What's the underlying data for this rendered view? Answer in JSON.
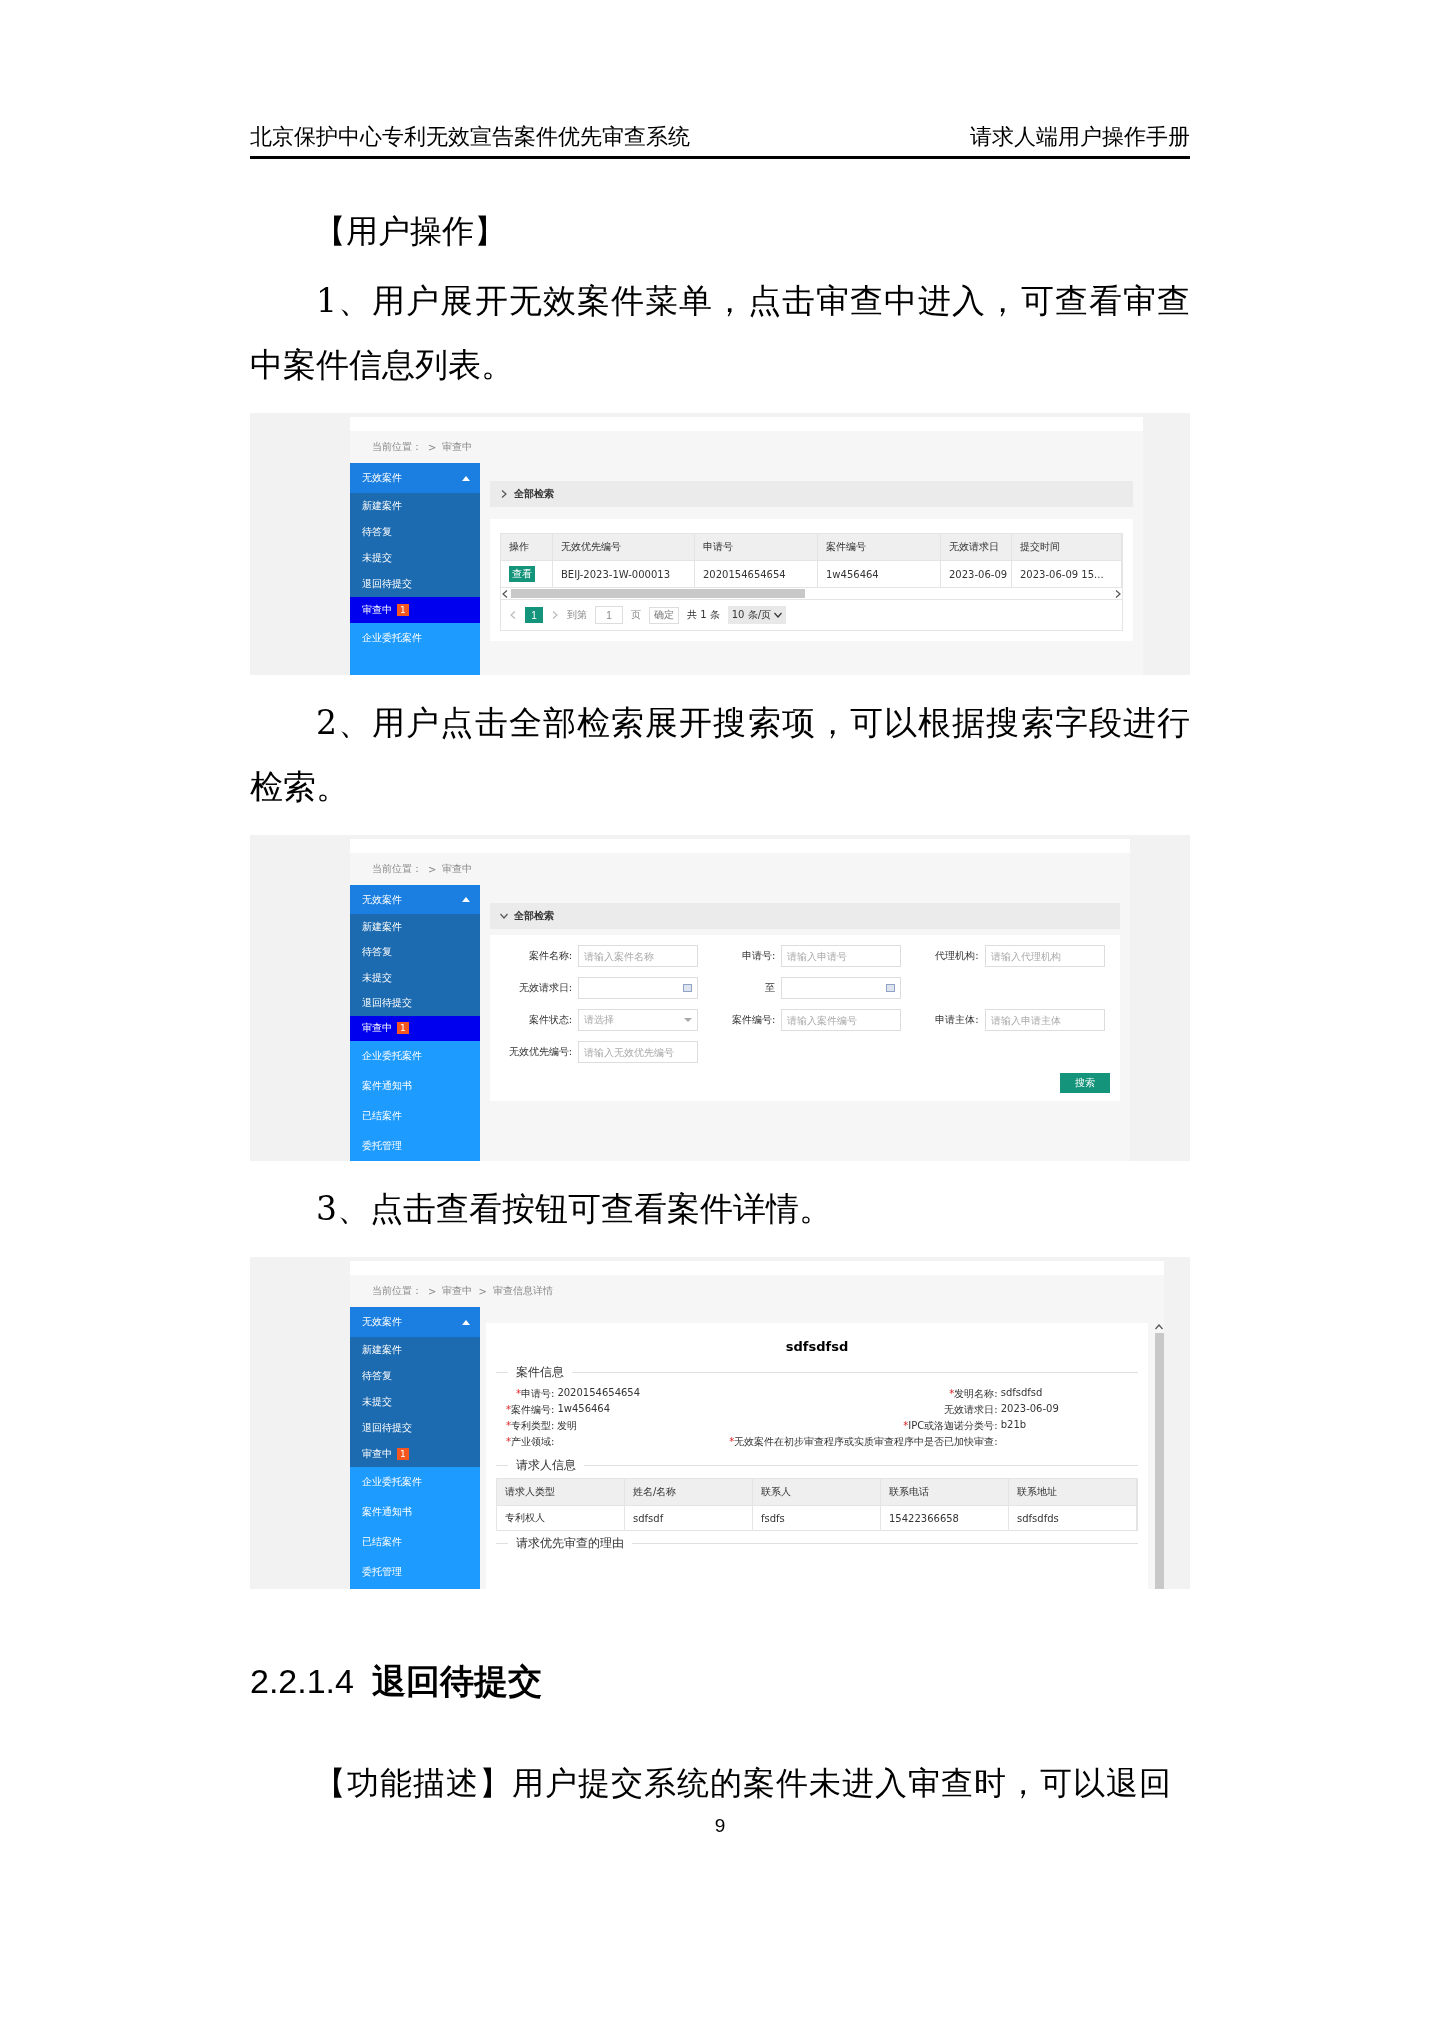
{
  "header": {
    "left": "北京保护中心专利无效宣告案件优先审查系统",
    "right": "请求人端用户操作手册"
  },
  "section_label": "【用户操作】",
  "steps": [
    {
      "text": "1、用户展开无效案件菜单，点击审查中进入，可查看审查中案件信息列表。",
      "screen": {
        "kind": "list",
        "breadcrumb": [
          "当前位置：",
          ">",
          "审查中"
        ],
        "sidebar": {
          "title": "无效案件",
          "expanded": true,
          "items": [
            {
              "label": "新建案件",
              "selected": false
            },
            {
              "label": "待答复",
              "selected": false
            },
            {
              "label": "未提交",
              "selected": false
            },
            {
              "label": "退回待提交",
              "selected": false
            },
            {
              "label": "审查中",
              "selected": true,
              "badge": "1"
            }
          ],
          "other_items": [
            "企业委托案件"
          ]
        },
        "filter": {
          "label": "全部检索",
          "expanded": false
        },
        "table": {
          "columns": [
            {
              "label": "操作",
              "kind": "action"
            },
            {
              "label": "无效优先编号",
              "kind": "text"
            },
            {
              "label": "申请号",
              "kind": "text"
            },
            {
              "label": "案件编号",
              "kind": "text"
            },
            {
              "label": "无效请求日",
              "kind": "text"
            },
            {
              "label": "提交时间",
              "kind": "text"
            }
          ],
          "rows": [
            [
              "查看",
              "BEIJ-2023-1W-000013",
              "2020154654654",
              "1w456464",
              "2023-06-09",
              "2023-06-09 15..."
            ]
          ]
        },
        "pagination": {
          "pages": [
            {
              "label": "1",
              "selected": true
            }
          ],
          "goto": "到第",
          "page_input": "1",
          "page_unit": "页",
          "confirm": "确定",
          "total": "共 1 条",
          "page_size": "10 条/页"
        }
      }
    },
    {
      "text": "2、用户点击全部检索展开搜索项，可以根据搜索字段进行检索。",
      "screen": {
        "kind": "search",
        "breadcrumb": [
          "当前位置：",
          ">",
          "审查中"
        ],
        "sidebar": {
          "title": "无效案件",
          "expanded": true,
          "items": [
            {
              "label": "新建案件",
              "selected": false
            },
            {
              "label": "待答复",
              "selected": false
            },
            {
              "label": "未提交",
              "selected": false
            },
            {
              "label": "退回待提交",
              "selected": false
            },
            {
              "label": "审查中",
              "selected": true,
              "badge": "1"
            }
          ],
          "other_items": [
            "企业委托案件",
            "案件通知书",
            "已结案件",
            "委托管理"
          ]
        },
        "filter": {
          "label": "全部检索",
          "expanded": true
        },
        "form_rows": [
          [
            {
              "label": "案件名称:",
              "kind": "text",
              "placeholder": "请输入案件名称"
            },
            {
              "label": "申请号:",
              "kind": "text",
              "placeholder": "请输入申请号"
            },
            {
              "label": "代理机构:",
              "kind": "text",
              "placeholder": "请输入代理机构"
            }
          ],
          [
            {
              "label": "无效请求日:",
              "kind": "date"
            },
            {
              "label": "至",
              "kind": "date"
            }
          ],
          [
            {
              "label": "案件状态:",
              "kind": "select",
              "placeholder": "请选择"
            },
            {
              "label": "案件编号:",
              "kind": "text",
              "placeholder": "请输入案件编号"
            },
            {
              "label": "申请主体:",
              "kind": "text",
              "placeholder": "请输入申请主体"
            }
          ],
          [
            {
              "label": "无效优先编号:",
              "kind": "text",
              "placeholder": "请输入无效优先编号"
            }
          ]
        ],
        "search_button": "搜索"
      }
    },
    {
      "text": "3、点击查看按钮可查看案件详情。",
      "screen": {
        "kind": "detail",
        "breadcrumb": [
          "当前位置：",
          ">",
          "审查中",
          ">",
          "审查信息详情"
        ],
        "sidebar": {
          "title": "无效案件",
          "expanded": true,
          "items": [
            {
              "label": "新建案件",
              "selected": false
            },
            {
              "label": "待答复",
              "selected": false
            },
            {
              "label": "未提交",
              "selected": false
            },
            {
              "label": "退回待提交",
              "selected": false
            },
            {
              "label": "审查中",
              "selected": false,
              "badge": "1"
            }
          ],
          "other_items": [
            "企业委托案件",
            "案件通知书",
            "已结案件",
            "委托管理"
          ]
        },
        "title": "sdfsdfsd",
        "case_section": "案件信息",
        "required_mark": "*",
        "fields": [
          {
            "label": "申请号:",
            "value": "2020154654654",
            "required": true
          },
          {
            "label": "发明名称:",
            "value": "sdfsdfsd",
            "required": true
          },
          {
            "label": "案件编号:",
            "value": "1w456464",
            "required": true
          },
          {
            "label": "无效请求日:",
            "value": "2023-06-09",
            "required": false
          },
          {
            "label": "专利类型:",
            "value": "发明",
            "required": true
          },
          {
            "label": "IPC或洛迦诺分类号:",
            "value": "b21b",
            "required": true
          },
          {
            "label": "产业领域:",
            "required": true
          },
          {
            "label": "无效案件在初步审查程序或实质审查程序中是否已加快审查:",
            "required": true
          }
        ],
        "requester_section": "请求人信息",
        "table": {
          "columns": [
            "请求人类型",
            "姓名/名称",
            "联系人",
            "联系电话",
            "联系地址"
          ],
          "rows": [
            [
              "专利权人",
              "sdfsdf",
              "fsdfs",
              "15422366658",
              "sdfsdfds"
            ]
          ]
        },
        "reason_section": "请求优先审查的理由"
      }
    }
  ],
  "section": {
    "number": "2.2.1.4",
    "title": "退回待提交"
  },
  "description": "【功能描述】用户提交系统的案件未进入审查时，可以退回",
  "page_number": "9"
}
